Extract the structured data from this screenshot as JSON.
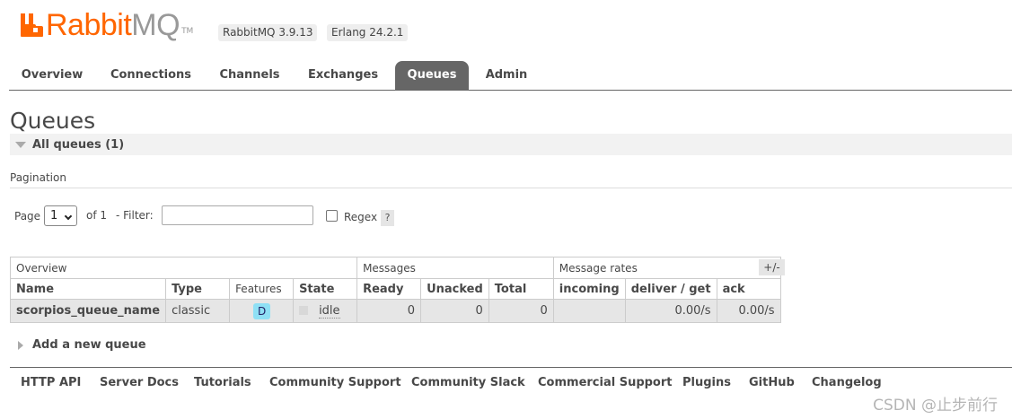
{
  "header": {
    "logo_text_main": "Rabbit",
    "logo_text_accent": "MQ",
    "logo_tm": "TM",
    "rabbitmq_version": "RabbitMQ 3.9.13",
    "erlang_version": "Erlang 24.2.1",
    "brand_color": "#ff6600"
  },
  "tabs": [
    {
      "label": "Overview",
      "active": false
    },
    {
      "label": "Connections",
      "active": false
    },
    {
      "label": "Channels",
      "active": false
    },
    {
      "label": "Exchanges",
      "active": false
    },
    {
      "label": "Queues",
      "active": true
    },
    {
      "label": "Admin",
      "active": false
    }
  ],
  "page": {
    "title": "Queues",
    "section_title": "All queues (1)"
  },
  "pagination": {
    "label": "Pagination",
    "page_label": "Page",
    "page_value": "1",
    "of_label": "of 1",
    "filter_label": "- Filter:",
    "filter_value": "",
    "regex_label": "Regex",
    "regex_checked": false,
    "help_label": "?"
  },
  "table": {
    "groups": [
      "Overview",
      "Messages",
      "Message rates"
    ],
    "columns": [
      "Name",
      "Type",
      "Features",
      "State",
      "Ready",
      "Unacked",
      "Total",
      "incoming",
      "deliver / get",
      "ack"
    ],
    "columns_toggle": "+/-",
    "rows": [
      {
        "name": "scorpios_queue_name",
        "type": "classic",
        "feature": "D",
        "state": "idle",
        "ready": "0",
        "unacked": "0",
        "total": "0",
        "incoming": "",
        "deliver_get": "0.00/s",
        "ack": "0.00/s"
      }
    ]
  },
  "add_queue": {
    "label": "Add a new queue"
  },
  "footer": {
    "links": [
      "HTTP API",
      "Server Docs",
      "Tutorials",
      "Community Support",
      "Community Slack",
      "Commercial Support",
      "Plugins",
      "GitHub",
      "Changelog"
    ],
    "watermark": "CSDN @止步前行"
  }
}
